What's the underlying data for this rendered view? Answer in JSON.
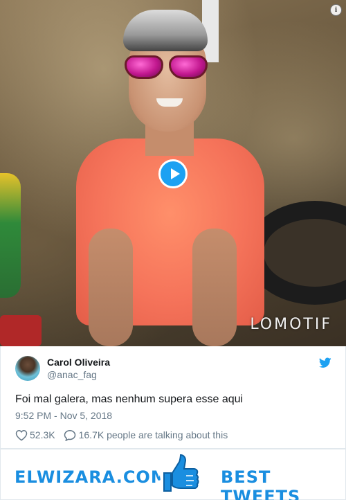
{
  "video": {
    "watermark": "LOMOTIF",
    "play_icon": "play-icon",
    "info_icon": "info-icon",
    "info_glyph": "i"
  },
  "tweet": {
    "author_name": "Carol Oliveira",
    "author_handle": "@anac_fag",
    "text": "Foi mal galera, mas nenhum supera esse aqui",
    "time": "9:52 PM - Nov 5, 2018",
    "likes": "52.3K",
    "talking": "16.7K people are talking about this",
    "accent_color": "#1da1f2"
  },
  "banner": {
    "left_text": "ELWIZARA.COM",
    "right_text": "BEST TWEETS",
    "icon": "thumbs-up-icon",
    "color": "#1a8ee0"
  }
}
